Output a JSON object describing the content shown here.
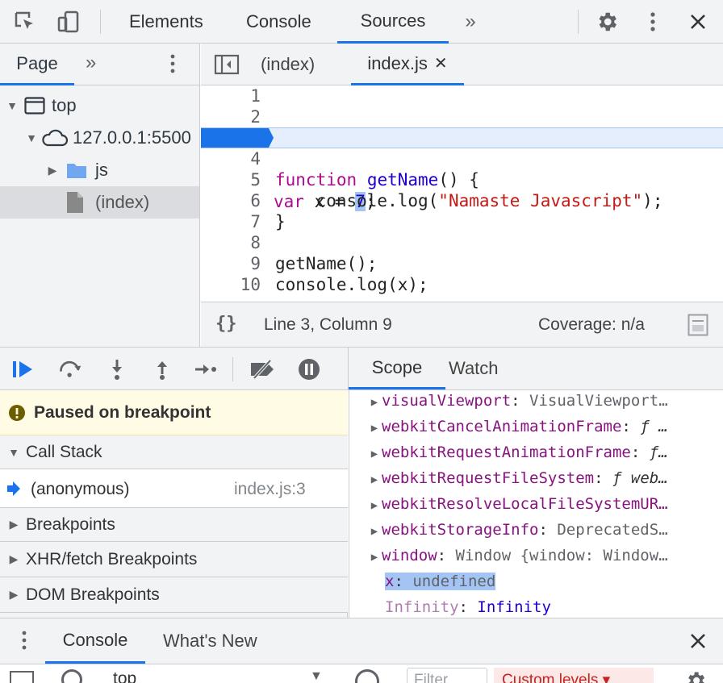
{
  "toolbar": {
    "tabs": [
      "Elements",
      "Console",
      "Sources"
    ],
    "active_tab": "Sources",
    "more_icon": "chevron-double-right-icon",
    "settings_icon": "gear-icon",
    "menu_icon": "kebab-icon",
    "close_icon": "close-icon"
  },
  "navigator": {
    "tab": "Page",
    "tree": [
      {
        "label": "top",
        "icon": "frame-icon",
        "expanded": true
      },
      {
        "label": "127.0.0.1:5500",
        "icon": "cloud-icon",
        "expanded": true
      },
      {
        "label": "js",
        "icon": "folder-icon",
        "expanded": false
      },
      {
        "label": "(index)",
        "icon": "file-icon",
        "selected": true
      }
    ]
  },
  "editor": {
    "tabs": [
      "(index)",
      "index.js"
    ],
    "active_tab": "index.js",
    "breakpoint_line": 3,
    "lines": [
      {
        "n": "1",
        "text": ""
      },
      {
        "n": "2",
        "text": ""
      },
      {
        "n": "3",
        "text": "var x = 7;"
      },
      {
        "n": "4",
        "text": ""
      },
      {
        "n": "5",
        "text": "function getName() {"
      },
      {
        "n": "6",
        "text": "    console.log(\"Namaste Javascript\");"
      },
      {
        "n": "7",
        "text": "}"
      },
      {
        "n": "8",
        "text": ""
      },
      {
        "n": "9",
        "text": "getName();"
      },
      {
        "n": "10",
        "text": "console.log(x);"
      }
    ],
    "status": {
      "format_label": "{}",
      "position": "Line 3, Column 9",
      "coverage": "Coverage: n/a"
    }
  },
  "debugger": {
    "controls": [
      "resume-icon",
      "step-over-icon",
      "step-into-icon",
      "step-out-icon",
      "step-icon",
      "deactivate-breakpoints-icon",
      "pause-on-exceptions-icon"
    ],
    "paused_message": "Paused on breakpoint",
    "call_stack_label": "Call Stack",
    "call_stack": [
      {
        "fn": "(anonymous)",
        "location": "index.js:3"
      }
    ],
    "sections": [
      "Breakpoints",
      "XHR/fetch Breakpoints",
      "DOM Breakpoints"
    ]
  },
  "scope": {
    "tabs": [
      "Scope",
      "Watch"
    ],
    "active_tab": "Scope",
    "rows": [
      {
        "key": "visualViewport",
        "value": "VisualViewport…"
      },
      {
        "key": "webkitCancelAnimationFrame",
        "value": "ƒ …"
      },
      {
        "key": "webkitRequestAnimationFrame",
        "value": "ƒ…"
      },
      {
        "key": "webkitRequestFileSystem",
        "value": "ƒ web…"
      },
      {
        "key": "webkitResolveLocalFileSystemUR…",
        "value": ""
      },
      {
        "key": "webkitStorageInfo",
        "value": "DeprecatedS…"
      },
      {
        "key": "window",
        "value": "Window {window: Window…"
      },
      {
        "key": "x",
        "value": "undefined"
      },
      {
        "key": "Infinity",
        "value": "Infinity"
      }
    ]
  },
  "drawer": {
    "tabs": [
      "Console",
      "What's New"
    ],
    "active_tab": "Console",
    "context": "top",
    "filter_placeholder": "Filter",
    "levels": "Custom levels ▾"
  },
  "colors": {
    "accent": "#1a73e8",
    "breakpoint_bg": "#e5eefc",
    "paused_bg": "#fffbe5",
    "scope_key": "#881280"
  }
}
